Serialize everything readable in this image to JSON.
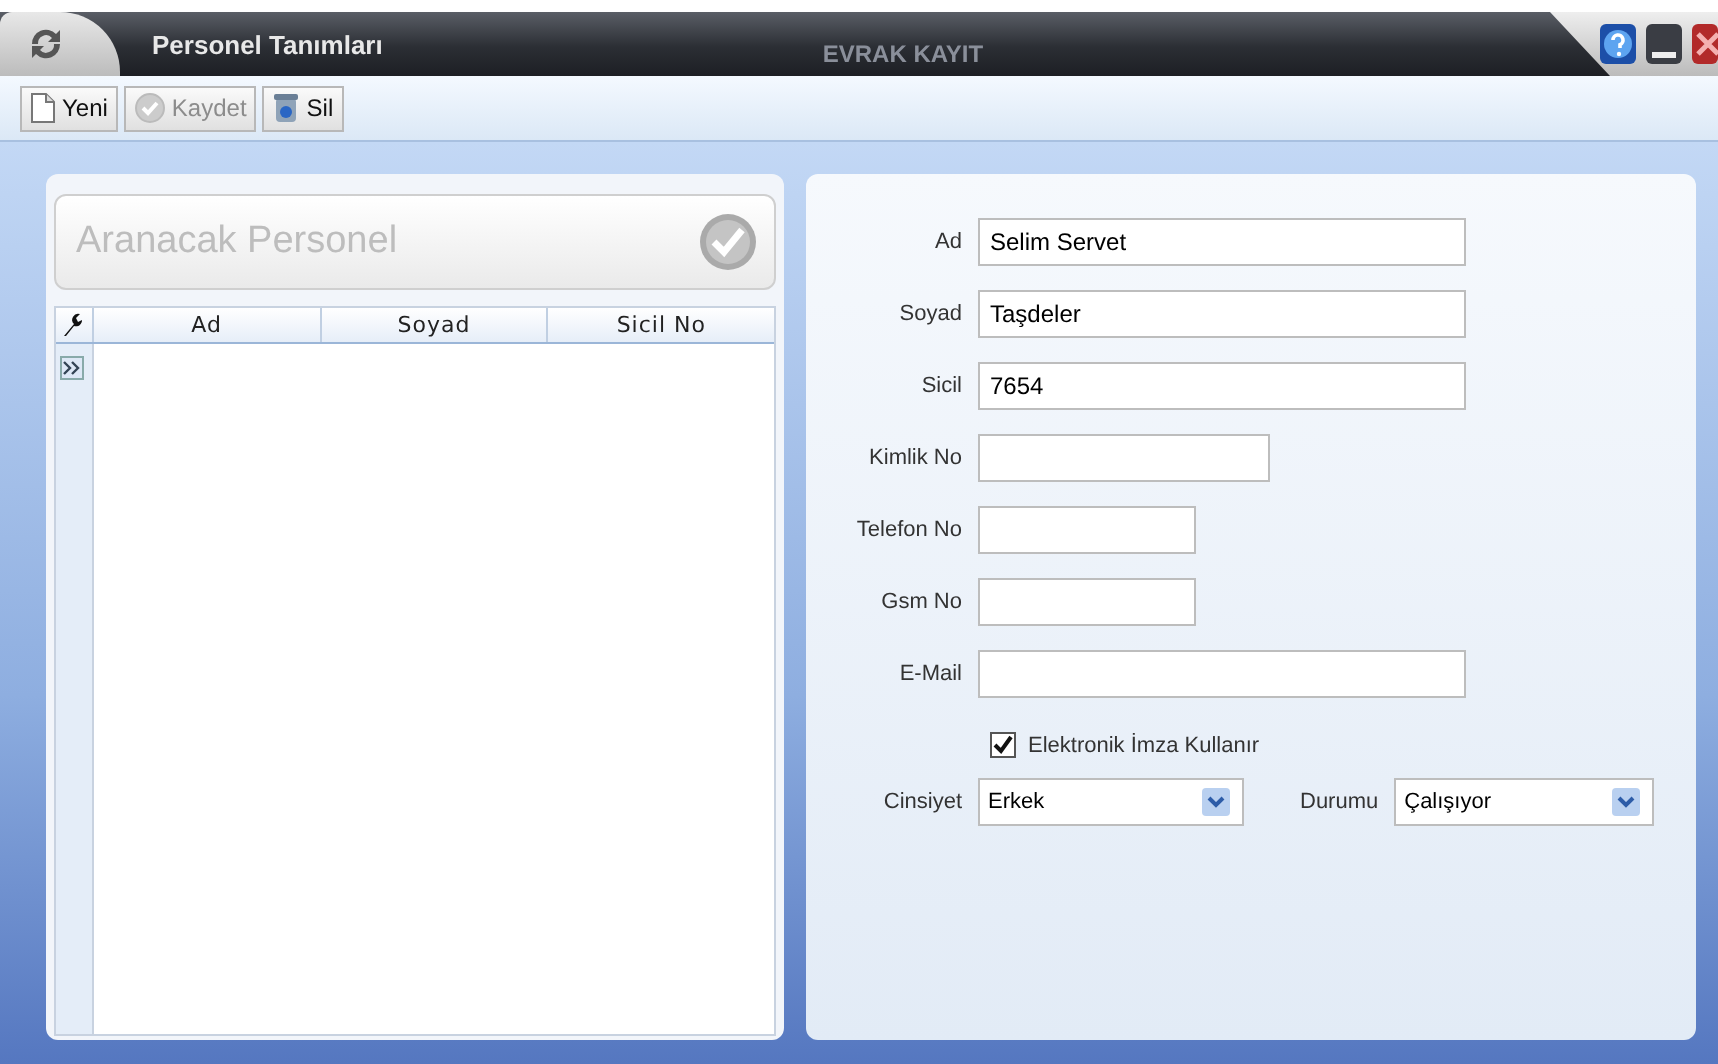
{
  "window": {
    "title": "Personel Tanımları",
    "subtitle": "EVRAK KAYIT"
  },
  "toolbar": [
    {
      "label": "Yeni",
      "kind": "new",
      "disabled": false
    },
    {
      "label": "Kaydet",
      "kind": "save",
      "disabled": true
    },
    {
      "label": "Sil",
      "kind": "delete",
      "disabled": false
    }
  ],
  "search": {
    "placeholder": "Aranacak Personel"
  },
  "table": {
    "columns": [
      "Ad",
      "Soyad",
      "Sicil No"
    ]
  },
  "form": {
    "fields": [
      {
        "label": "Ad",
        "value": "Selim Servet"
      },
      {
        "label": "Soyad",
        "value": "Taşdeler"
      },
      {
        "label": "Sicil",
        "value": "7654"
      },
      {
        "label": "Kimlik No"
      },
      {
        "label": "Telefon No"
      },
      {
        "label": "Gsm No"
      },
      {
        "label": "E-Mail"
      }
    ],
    "checkbox": {
      "label": "Elektronik İmza Kullanır",
      "checked": true
    },
    "selects": [
      {
        "label": "Cinsiyet",
        "value": "Erkek"
      },
      {
        "label": "Durumu",
        "value": "Çalışıyor"
      }
    ]
  }
}
